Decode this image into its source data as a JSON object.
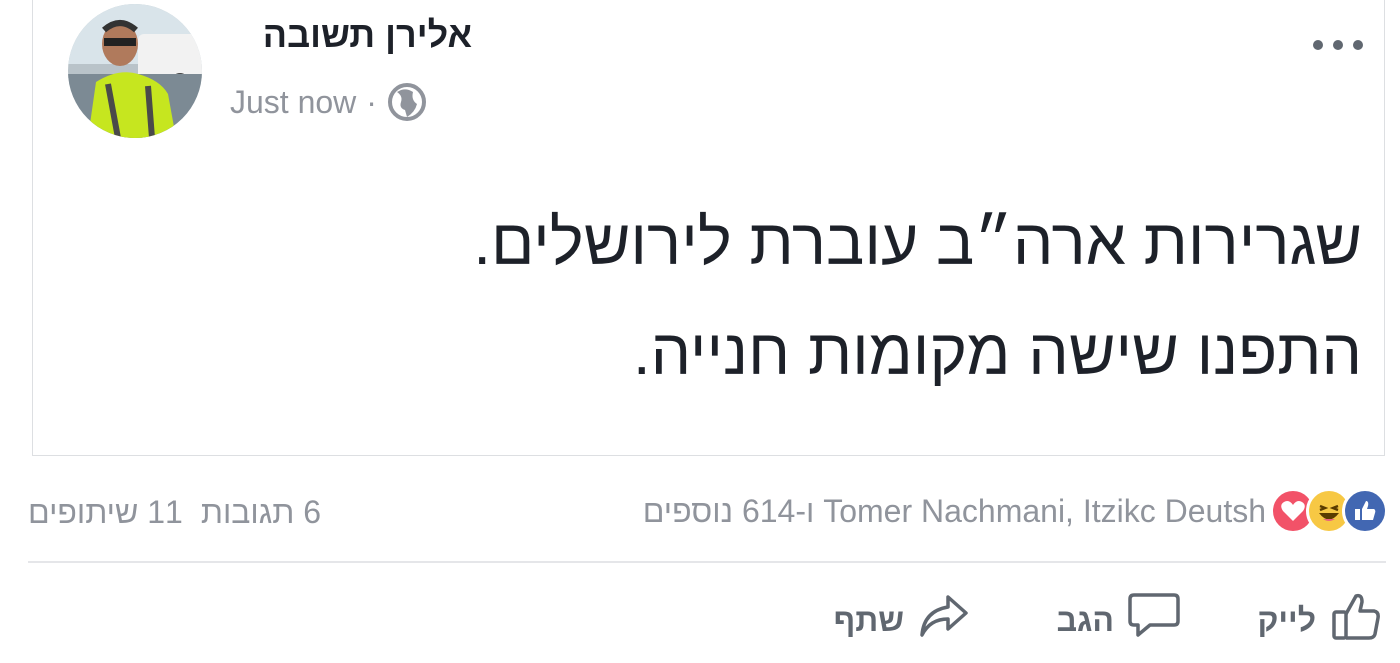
{
  "post": {
    "author_name": "אלירן תשובה",
    "timestamp": "Just now",
    "separator": "·",
    "privacy_icon": "globe-icon",
    "menu_icon": "more-options-icon",
    "text_lines": [
      "שגרירות ארה״ב עוברת לירושלים.",
      "התפנו שישה מקומות חנייה."
    ]
  },
  "reactions": {
    "icons": [
      "like-reaction-icon",
      "haha-reaction-icon",
      "love-reaction-icon"
    ],
    "colors": {
      "like": "#4267b2",
      "haha": "#f7c844",
      "love": "#f25268"
    },
    "summary": "Tomer Nachmani, Itzikc Deutsh ו-614 נוספים",
    "comments": "6 תגובות",
    "shares": "11 שיתופים"
  },
  "actions": {
    "like_label": "לייק",
    "comment_label": "הגב",
    "share_label": "שתף"
  }
}
